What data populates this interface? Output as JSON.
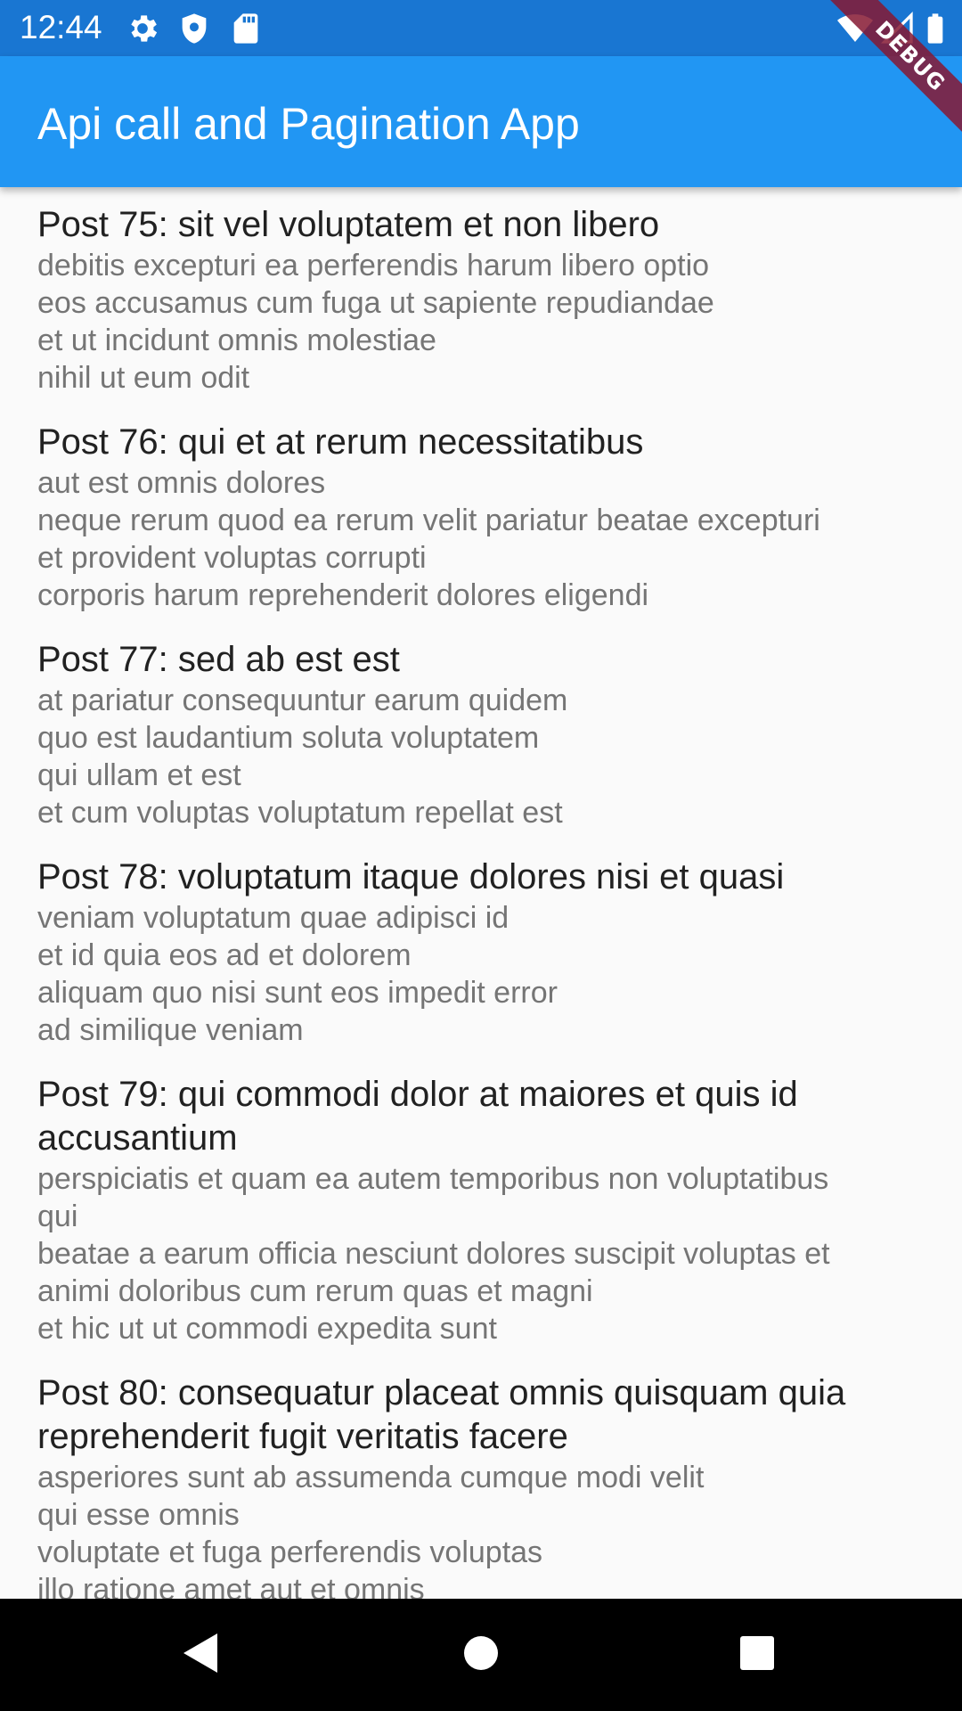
{
  "status_bar": {
    "time": "12:44",
    "debug_label": "DEBUG",
    "icons": [
      "settings-icon",
      "shield-icon",
      "sd-card-icon",
      "wifi-icon",
      "signal-icon",
      "battery-icon"
    ]
  },
  "app_bar": {
    "title": "Api call and Pagination App",
    "color": "#2196f3"
  },
  "posts": [
    {
      "title": "Post 75: sit vel voluptatem et non libero",
      "body": "debitis excepturi ea perferendis harum libero optio\neos accusamus cum fuga ut sapiente repudiandae\net ut incidunt omnis molestiae\nnihil ut eum odit"
    },
    {
      "title": "Post 76: qui et at rerum necessitatibus",
      "body": "aut est omnis dolores\nneque rerum quod ea rerum velit pariatur beatae excepturi\net provident voluptas corrupti\ncorporis harum reprehenderit dolores eligendi"
    },
    {
      "title": "Post 77: sed ab est est",
      "body": "at pariatur consequuntur earum quidem\nquo est laudantium soluta voluptatem\nqui ullam et est\net cum voluptas voluptatum repellat est"
    },
    {
      "title": "Post 78: voluptatum itaque dolores nisi et quasi",
      "body": "veniam voluptatum quae adipisci id\net id quia eos ad et dolorem\naliquam quo nisi sunt eos impedit error\nad similique veniam"
    },
    {
      "title": "Post 79: qui commodi dolor at maiores et quis id\naccusantium",
      "body": "perspiciatis et quam ea autem temporibus non voluptatibus\nqui\nbeatae a earum officia nesciunt dolores suscipit voluptas et\nanimi doloribus cum rerum quas et magni\net hic ut ut commodi expedita sunt"
    },
    {
      "title": "Post 80: consequatur placeat omnis quisquam quia\nreprehenderit fugit veritatis facere",
      "body": "asperiores sunt ab assumenda cumque modi velit\nqui esse omnis\nvoluptate et fuga perferendis voluptas\nillo ratione amet aut et omnis"
    }
  ],
  "nav_bar": {
    "buttons": [
      "back-icon",
      "home-icon",
      "recents-icon"
    ]
  }
}
